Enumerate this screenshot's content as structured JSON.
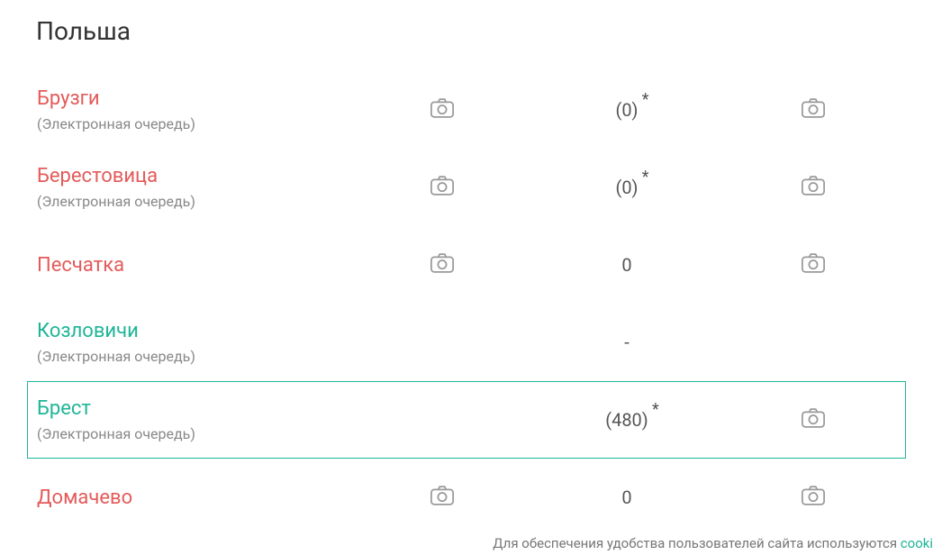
{
  "section_title": "Польша",
  "sublabel": "(Электронная очередь)",
  "rows": [
    {
      "name": "Брузги",
      "color": "red",
      "has_sub": true,
      "cam1": true,
      "value": "(0)",
      "star": true,
      "cam2": true,
      "selected": false
    },
    {
      "name": "Берестовица",
      "color": "red",
      "has_sub": true,
      "cam1": true,
      "value": "(0)",
      "star": true,
      "cam2": true,
      "selected": false
    },
    {
      "name": "Песчатка",
      "color": "red",
      "has_sub": false,
      "cam1": true,
      "value": "0",
      "star": false,
      "cam2": true,
      "selected": false
    },
    {
      "name": "Козловичи",
      "color": "green",
      "has_sub": true,
      "cam1": false,
      "value": "-",
      "star": false,
      "cam2": false,
      "selected": false
    },
    {
      "name": "Брест",
      "color": "green",
      "has_sub": true,
      "cam1": false,
      "value": "(480)",
      "star": true,
      "cam2": true,
      "selected": true
    },
    {
      "name": "Домачево",
      "color": "red",
      "has_sub": false,
      "cam1": true,
      "value": "0",
      "star": false,
      "cam2": true,
      "selected": false
    }
  ],
  "footer": {
    "text": "Для обеспечения удобства пользователей сайта используются ",
    "link": "cooki"
  }
}
